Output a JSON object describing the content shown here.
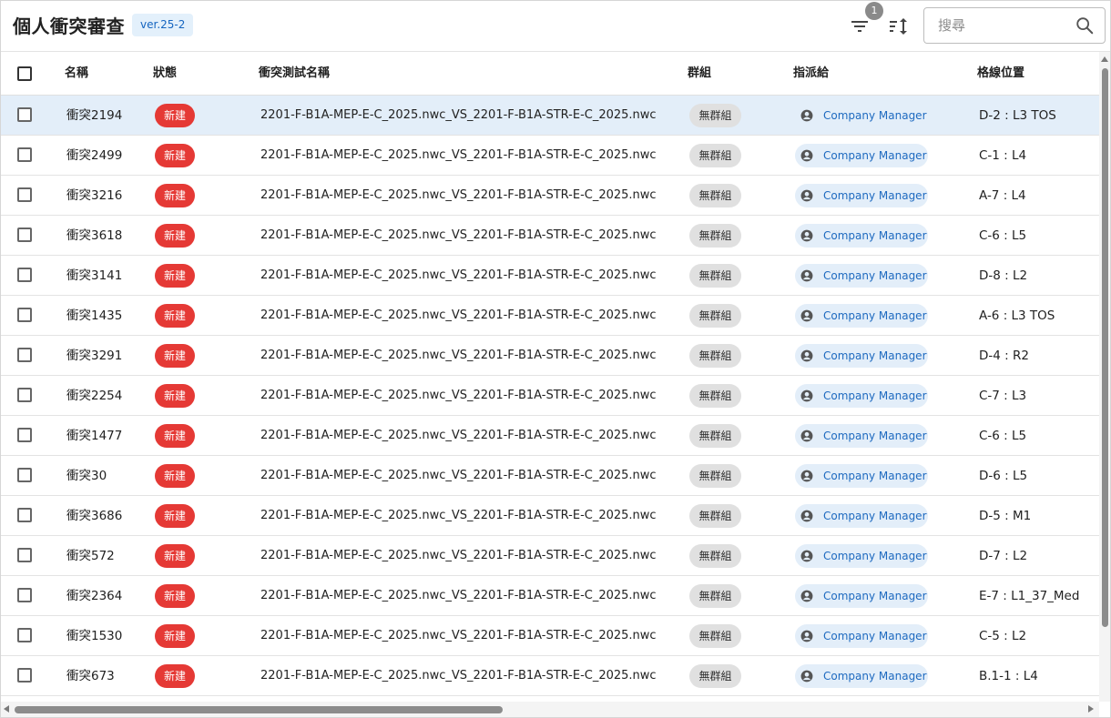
{
  "header": {
    "title": "個人衝突審查",
    "version": "ver.25-2",
    "filter_count": "1",
    "search_placeholder": "搜尋"
  },
  "columns": {
    "name": "名稱",
    "status": "狀態",
    "test_name": "衝突測試名稱",
    "group": "群組",
    "assignee": "指派給",
    "grid_location": "格線位置"
  },
  "colors": {
    "status_new": "#e53935",
    "selected_row": "#e3eef9",
    "accent": "#1e6ac0"
  },
  "rows": [
    {
      "name": "衝突2194",
      "status": "新建",
      "test": "2201-F-B1A-MEP-E-C_2025.nwc_VS_2201-F-B1A-STR-E-C_2025.nwc",
      "group": "無群組",
      "assignee": "Company Manager",
      "grid": "D-2 : L3 TOS",
      "selected": true
    },
    {
      "name": "衝突2499",
      "status": "新建",
      "test": "2201-F-B1A-MEP-E-C_2025.nwc_VS_2201-F-B1A-STR-E-C_2025.nwc",
      "group": "無群組",
      "assignee": "Company Manager",
      "grid": "C-1 : L4"
    },
    {
      "name": "衝突3216",
      "status": "新建",
      "test": "2201-F-B1A-MEP-E-C_2025.nwc_VS_2201-F-B1A-STR-E-C_2025.nwc",
      "group": "無群組",
      "assignee": "Company Manager",
      "grid": "A-7 : L4"
    },
    {
      "name": "衝突3618",
      "status": "新建",
      "test": "2201-F-B1A-MEP-E-C_2025.nwc_VS_2201-F-B1A-STR-E-C_2025.nwc",
      "group": "無群組",
      "assignee": "Company Manager",
      "grid": "C-6 : L5"
    },
    {
      "name": "衝突3141",
      "status": "新建",
      "test": "2201-F-B1A-MEP-E-C_2025.nwc_VS_2201-F-B1A-STR-E-C_2025.nwc",
      "group": "無群組",
      "assignee": "Company Manager",
      "grid": "D-8 : L2"
    },
    {
      "name": "衝突1435",
      "status": "新建",
      "test": "2201-F-B1A-MEP-E-C_2025.nwc_VS_2201-F-B1A-STR-E-C_2025.nwc",
      "group": "無群組",
      "assignee": "Company Manager",
      "grid": "A-6 : L3 TOS"
    },
    {
      "name": "衝突3291",
      "status": "新建",
      "test": "2201-F-B1A-MEP-E-C_2025.nwc_VS_2201-F-B1A-STR-E-C_2025.nwc",
      "group": "無群組",
      "assignee": "Company Manager",
      "grid": "D-4 : R2"
    },
    {
      "name": "衝突2254",
      "status": "新建",
      "test": "2201-F-B1A-MEP-E-C_2025.nwc_VS_2201-F-B1A-STR-E-C_2025.nwc",
      "group": "無群組",
      "assignee": "Company Manager",
      "grid": "C-7 : L3"
    },
    {
      "name": "衝突1477",
      "status": "新建",
      "test": "2201-F-B1A-MEP-E-C_2025.nwc_VS_2201-F-B1A-STR-E-C_2025.nwc",
      "group": "無群組",
      "assignee": "Company Manager",
      "grid": "C-6 : L5"
    },
    {
      "name": "衝突30",
      "status": "新建",
      "test": "2201-F-B1A-MEP-E-C_2025.nwc_VS_2201-F-B1A-STR-E-C_2025.nwc",
      "group": "無群組",
      "assignee": "Company Manager",
      "grid": "D-6 : L5"
    },
    {
      "name": "衝突3686",
      "status": "新建",
      "test": "2201-F-B1A-MEP-E-C_2025.nwc_VS_2201-F-B1A-STR-E-C_2025.nwc",
      "group": "無群組",
      "assignee": "Company Manager",
      "grid": "D-5 : M1"
    },
    {
      "name": "衝突572",
      "status": "新建",
      "test": "2201-F-B1A-MEP-E-C_2025.nwc_VS_2201-F-B1A-STR-E-C_2025.nwc",
      "group": "無群組",
      "assignee": "Company Manager",
      "grid": "D-7 : L2"
    },
    {
      "name": "衝突2364",
      "status": "新建",
      "test": "2201-F-B1A-MEP-E-C_2025.nwc_VS_2201-F-B1A-STR-E-C_2025.nwc",
      "group": "無群組",
      "assignee": "Company Manager",
      "grid": "E-7 : L1_37_Med"
    },
    {
      "name": "衝突1530",
      "status": "新建",
      "test": "2201-F-B1A-MEP-E-C_2025.nwc_VS_2201-F-B1A-STR-E-C_2025.nwc",
      "group": "無群組",
      "assignee": "Company Manager",
      "grid": "C-5 : L2"
    },
    {
      "name": "衝突673",
      "status": "新建",
      "test": "2201-F-B1A-MEP-E-C_2025.nwc_VS_2201-F-B1A-STR-E-C_2025.nwc",
      "group": "無群組",
      "assignee": "Company Manager",
      "grid": "B.1-1 : L4"
    }
  ]
}
